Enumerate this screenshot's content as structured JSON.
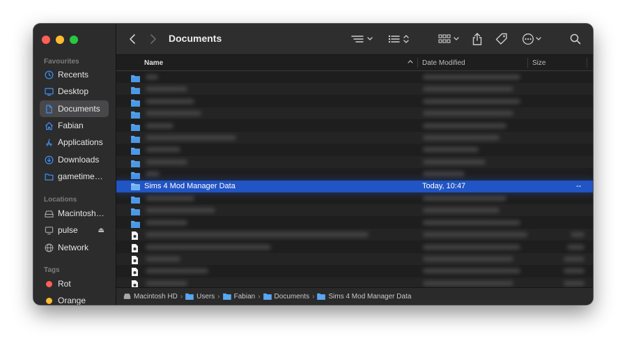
{
  "window": {
    "title": "Documents"
  },
  "sidebar": {
    "favourites_heading": "Favourites",
    "favourites": [
      {
        "label": "Recents",
        "icon": "clock-icon"
      },
      {
        "label": "Desktop",
        "icon": "desktop-icon"
      },
      {
        "label": "Documents",
        "icon": "document-icon",
        "active": true
      },
      {
        "label": "Fabian",
        "icon": "home-icon"
      },
      {
        "label": "Applications",
        "icon": "applications-icon"
      },
      {
        "label": "Downloads",
        "icon": "download-icon"
      },
      {
        "label": "gametime…",
        "icon": "folder-icon"
      }
    ],
    "locations_heading": "Locations",
    "locations": [
      {
        "label": "Macintosh…",
        "icon": "harddisk-icon"
      },
      {
        "label": "pulse",
        "icon": "computer-icon",
        "eject": "⏏"
      },
      {
        "label": "Network",
        "icon": "globe-icon"
      }
    ],
    "tags_heading": "Tags",
    "tags": [
      {
        "label": "Rot",
        "color": "#ff5f57"
      },
      {
        "label": "Orange",
        "color": "#febc2e"
      }
    ]
  },
  "columns": {
    "name": "Name",
    "date_modified": "Date Modified",
    "size": "Size"
  },
  "selected_row": {
    "name": "Sims 4 Mod Manager Data",
    "date_modified": "Today, 10:47",
    "size": "--"
  },
  "pathbar": [
    "Macintosh HD",
    "Users",
    "Fabian",
    "Documents",
    "Sims 4 Mod Manager Data"
  ],
  "accent_color": "#2154c4"
}
